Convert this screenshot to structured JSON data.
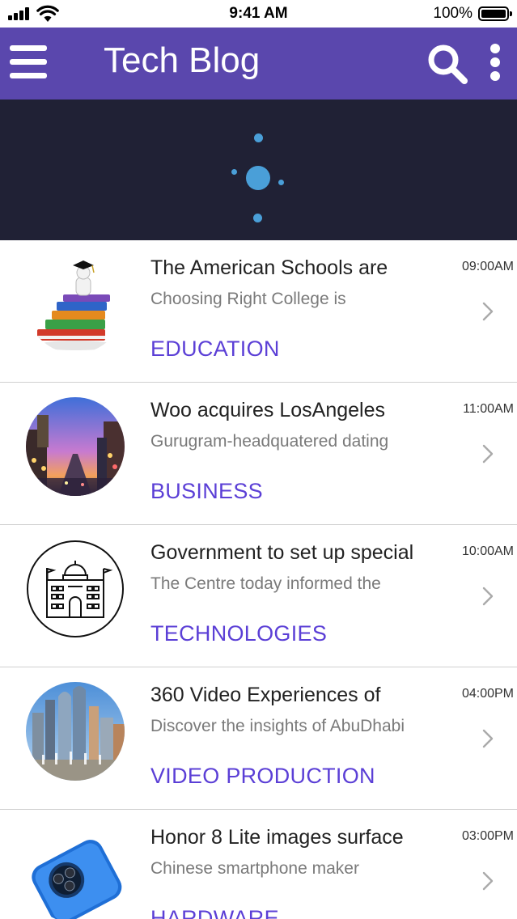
{
  "status_bar": {
    "time": "9:41 AM",
    "battery": "100%"
  },
  "app_bar": {
    "title": "Tech Blog",
    "menu_icon": "hamburger-menu-icon",
    "search_icon": "search-icon",
    "more_icon": "more-vertical-icon"
  },
  "hero": {
    "state": "loading",
    "spinner_color": "#4a9fd8"
  },
  "colors": {
    "app_bar": "#5a47ad",
    "hero_background": "#202135",
    "category": "#5b3fd6"
  },
  "posts": [
    {
      "title": "The American Schools are",
      "excerpt": "Choosing Right College is",
      "category": "EDUCATION",
      "time": "09:00AM",
      "thumbnail": "graduate-on-books-image"
    },
    {
      "title": "Woo acquires LosAngeles",
      "excerpt": "Gurugram-headquatered dating",
      "category": "BUSINESS",
      "time": "11:00AM",
      "thumbnail": "city-street-at-dusk-image"
    },
    {
      "title": "Government to set up special",
      "excerpt": "The Centre today informed the",
      "category": "TECHNOLOGIES",
      "time": "10:00AM",
      "thumbnail": "government-building-icon"
    },
    {
      "title": "360 Video Experiences of",
      "excerpt": "Discover the insights of AbuDhabi",
      "category": "VIDEO PRODUCTION",
      "time": "04:00PM",
      "thumbnail": "skyscrapers-image"
    },
    {
      "title": "Honor 8 Lite images surface",
      "excerpt": "Chinese smartphone maker",
      "category": "HARDWARE",
      "time": "03:00PM",
      "thumbnail": "blue-smartphone-image"
    }
  ]
}
